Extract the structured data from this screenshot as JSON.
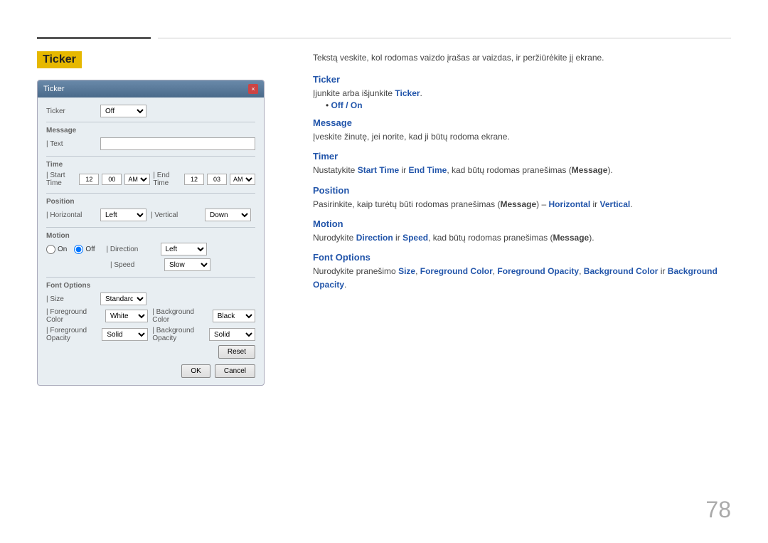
{
  "page": {
    "number": "78"
  },
  "header": {
    "section_title": "Ticker"
  },
  "dialog": {
    "title": "Ticker",
    "close_label": "×",
    "ticker_label": "Ticker",
    "ticker_value": "Off",
    "message_section": "Message",
    "text_label": "| Text",
    "text_placeholder": "",
    "time_section": "Time",
    "start_time_label": "| Start Time",
    "start_hour": "12",
    "start_min": "00",
    "start_ampm": "AM",
    "end_time_label": "| End Time",
    "end_hour": "12",
    "end_min": "03",
    "end_ampm": "AM",
    "position_section": "Position",
    "horizontal_label": "| Horizontal",
    "horizontal_value": "Left",
    "vertical_label": "| Vertical",
    "vertical_value": "Down",
    "motion_section": "Motion",
    "radio_on": "On",
    "radio_off": "Off",
    "direction_label": "| Direction",
    "direction_value": "Left",
    "speed_label": "| Speed",
    "speed_value": "Slow",
    "font_options_section": "Font Options",
    "size_label": "| Size",
    "size_value": "Standard",
    "fg_color_label": "| Foreground Color",
    "fg_color_value": "White",
    "bg_color_label": "| Background Color",
    "bg_color_value": "Black",
    "fg_opacity_label": "| Foreground Opacity",
    "fg_opacity_value": "Solid",
    "bg_opacity_label": "| Background Opacity",
    "bg_opacity_value": "Solid",
    "reset_button": "Reset",
    "ok_button": "OK",
    "cancel_button": "Cancel"
  },
  "right": {
    "intro": "Tekstą veskite, kol rodomas vaizdo įrašas ar vaizdas, ir peržiūrėkite jį ekrane.",
    "ticker_heading": "Ticker",
    "ticker_desc": "Įjunkite arba išjunkite ",
    "ticker_bold": "Ticker",
    "ticker_period": ".",
    "ticker_bullet_label": "Off / On",
    "message_heading": "Message",
    "message_desc": "Įveskite žinutę, jei norite, kad ji būtų rodoma ekrane.",
    "timer_heading": "Timer",
    "timer_desc_pre": "Nustatykite ",
    "timer_start_bold": "Start Time",
    "timer_ir1": " ir ",
    "timer_end_bold": "End Time",
    "timer_desc_mid": ", kad būtų rodomas pranešimas (",
    "timer_message_bold": "Message",
    "timer_desc_end": ").",
    "position_heading": "Position",
    "position_desc_pre": "Pasirinkite, kaip turėtų būti rodomas pranešimas (",
    "position_message_bold": "Message",
    "position_desc_mid": ") – ",
    "position_horizontal_bold": "Horizontal",
    "position_ir": " ir ",
    "position_vertical_bold": "Vertical",
    "position_desc_end": ".",
    "motion_heading": "Motion",
    "motion_desc_pre": "Nurodykite ",
    "motion_direction_bold": "Direction",
    "motion_ir": " ir ",
    "motion_speed_bold": "Speed",
    "motion_desc_mid": ", kad būtų rodomas pranešimas (",
    "motion_message_bold": "Message",
    "motion_desc_end": ").",
    "font_options_heading": "Font Options",
    "font_desc_pre": "Nurodykite pranešimo ",
    "font_size_bold": "Size",
    "font_comma1": ", ",
    "font_fg_bold": "Foreground Color",
    "font_comma2": ", ",
    "font_fgo_bold": "Foreground Opacity",
    "font_comma3": ", ",
    "font_bg_bold": "Background Color",
    "font_ir": " ir ",
    "font_bgo_bold": "Background Opacity",
    "font_desc_end": "."
  }
}
